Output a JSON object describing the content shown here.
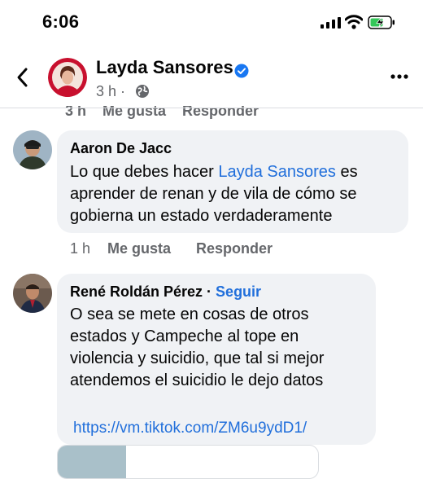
{
  "status_bar": {
    "time": "6:06"
  },
  "header": {
    "page_name": "Layda Sansores",
    "post_time": "3 h ·"
  },
  "partial_row": {
    "text": "3 h    Me gusta    Responder"
  },
  "comments": [
    {
      "author": "Aaron De Jacc",
      "text_before": "Lo que debes hacer ",
      "mention": "Layda Sansores",
      "text_after_line1": " es",
      "line2": "aprender de renan y de vila de cómo se",
      "line3": "gobierna un estado verdaderamente",
      "time": "1 h",
      "like": "Me gusta",
      "reply": "Responder"
    },
    {
      "author": "René Roldán Pérez",
      "dot": " · ",
      "follow": "Seguir",
      "line1": "O sea se mete en cosas de otros",
      "line2": "estados y Campeche al tope en",
      "line3": "violencia y suicidio, que tal si mejor",
      "line4": "atendemos el suicidio le dejo datos",
      "link": "https://vm.tiktok.com/ZM6u9ydD1/"
    }
  ],
  "colors": {
    "accent": "#216fdb",
    "bubble": "#f0f2f5",
    "muted": "#65676b",
    "verified": "#1877f2"
  },
  "icons": [
    "back-arrow-icon",
    "verified-badge-icon",
    "globe-icon",
    "more-options-icon",
    "signal-icon",
    "wifi-icon",
    "battery-charging-icon"
  ]
}
